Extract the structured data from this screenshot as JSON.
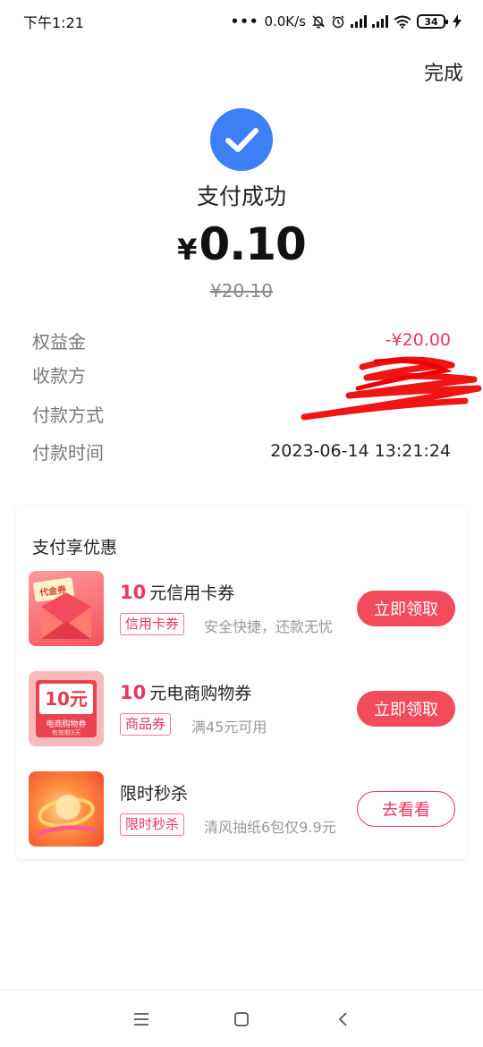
{
  "status_bar": {
    "time": "下午1:21",
    "net_speed": "0.0K/s",
    "battery": "34",
    "icons": [
      "dots-icon",
      "bell-off-icon",
      "alarm-icon",
      "signal-icon",
      "signal-icon",
      "wifi-icon",
      "battery-icon",
      "charging-icon"
    ]
  },
  "header": {
    "done_label": "完成"
  },
  "result": {
    "icon": "check-circle-icon",
    "title": "支付成功",
    "currency": "¥",
    "amount": "0.10",
    "original_amount": "¥20.10"
  },
  "details": [
    {
      "label": "权益金",
      "value": "-¥20.00",
      "color": "#e8385d"
    },
    {
      "label": "收款方",
      "value": ""
    },
    {
      "label": "付款方式",
      "value": ""
    },
    {
      "label": "付款时间",
      "value": "2023-06-14 13:21:24"
    }
  ],
  "promo": {
    "title": "支付享优惠",
    "items": [
      {
        "amount": "10",
        "title": "元信用卡券",
        "tag": "信用卡券",
        "desc": "安全快捷，还款无忧",
        "button": "立即领取",
        "thumb_label": "代金券"
      },
      {
        "amount": "10",
        "title": "元电商购物券",
        "tag": "商品券",
        "desc": "满45元可用",
        "button": "立即领取",
        "thumb_amount": "10元",
        "thumb_label": "电商购物券",
        "thumb_sub": "有效期3天"
      },
      {
        "title": "限时秒杀",
        "tag": "限时秒杀",
        "desc": "清风抽纸6包仅9.9元",
        "button": "去看看"
      }
    ]
  },
  "colors": {
    "accent_red": "#e8385d",
    "button_red": "#f24b5c",
    "success_blue": "#3d7ff5"
  },
  "nav": {
    "icons": [
      "menu-icon",
      "home-square-icon",
      "back-icon"
    ]
  }
}
